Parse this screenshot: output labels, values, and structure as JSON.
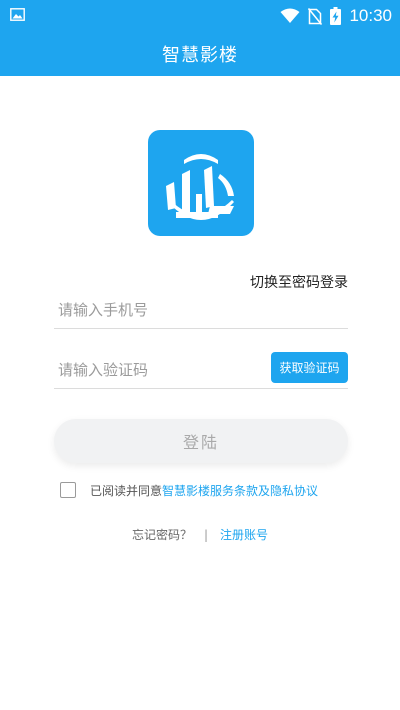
{
  "status_bar": {
    "time": "10:30",
    "icons": [
      "image-icon",
      "wifi-icon",
      "no-sim-icon",
      "battery-charging-icon"
    ]
  },
  "header": {
    "title": "智慧影楼"
  },
  "logo": {
    "icon": "city-building-logo-icon"
  },
  "login": {
    "switch_label": "切换至密码登录",
    "phone_placeholder": "请输入手机号",
    "code_placeholder": "请输入验证码",
    "get_code_label": "获取验证码",
    "submit_label": "登陆"
  },
  "agreement": {
    "prefix": "已阅读并同意",
    "link_text": "智慧影楼服务条款及隐私协议"
  },
  "footer": {
    "forgot_label": "忘记密码？",
    "divider": "|",
    "register_label": "注册账号"
  },
  "colors": {
    "primary": "#1ea5ef",
    "button_disabled_bg": "#f1f2f3",
    "button_disabled_text": "#a9a9a9"
  }
}
